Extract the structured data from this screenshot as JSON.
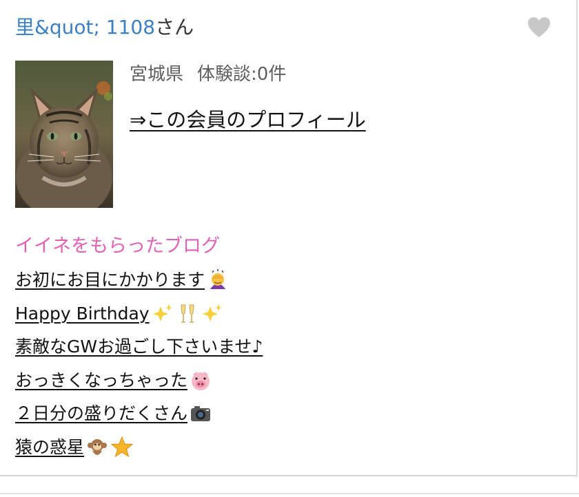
{
  "member": {
    "name": "里&quot; 1108",
    "name_suffix": "さん",
    "prefecture": "宮城県",
    "experience_count": "体験談:0件",
    "profile_link": "⇒この会員のプロフィール"
  },
  "icons": {
    "favorite": "heart-icon",
    "avatar": "cat-photo"
  },
  "colors": {
    "name_link": "#3b7fc4",
    "section_title": "#e45fb8",
    "heart": "#c8c8c8"
  },
  "liked_blogs": {
    "title": "イイネをもらったブログ",
    "items": [
      {
        "text": "お初にお目にかかります",
        "emoji": "bowing-woman-icon"
      },
      {
        "text": "Happy Birthday",
        "emoji": "sparkles-champagne-icon"
      },
      {
        "text": "素敵なGWお過ごし下さいませ♪",
        "emoji": ""
      },
      {
        "text": "おっきくなっちゃった",
        "emoji": "pig-face-icon"
      },
      {
        "text": "２日分の盛りだくさん",
        "emoji": "camera-icon"
      },
      {
        "text": "猿の惑星",
        "emoji": "monkey-star-icon"
      }
    ]
  }
}
